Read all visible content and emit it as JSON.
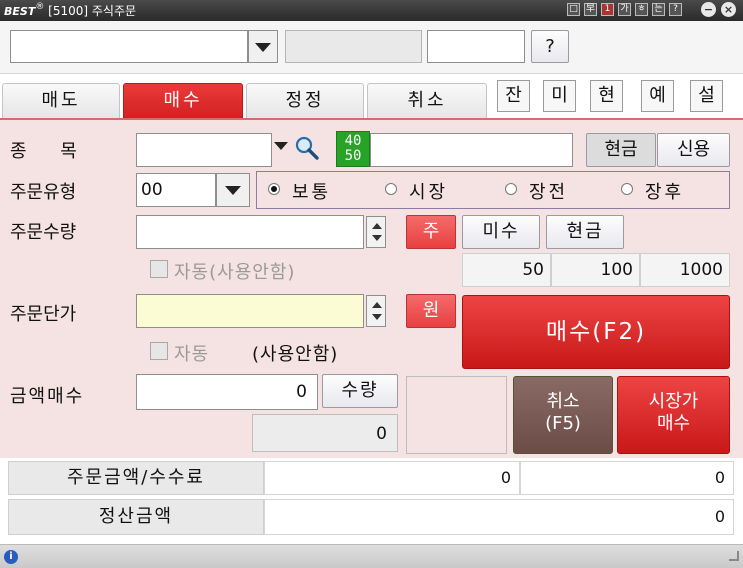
{
  "window": {
    "brand": "BEST",
    "title": "[5100] 주식주문",
    "title_buttons": [
      "□",
      "早",
      "1",
      "가",
      "ㅎ",
      "는",
      "?"
    ],
    "close_glyph": "×",
    "minimize_glyph": "−"
  },
  "toprow": {
    "help_label": "?"
  },
  "tabs": [
    {
      "label": "매도",
      "active": false
    },
    {
      "label": "매수",
      "active": true
    },
    {
      "label": "정정",
      "active": false
    },
    {
      "label": "취소",
      "active": false
    }
  ],
  "info_tabs": [
    "잔",
    "미",
    "현",
    "예",
    "설"
  ],
  "stock": {
    "label": "종 목",
    "search_icon": "magnifier-icon",
    "badge_top": "40",
    "badge_bottom": "50",
    "cash_label": "현금",
    "credit_label": "신용"
  },
  "order_type": {
    "label": "주문유형",
    "value": "00",
    "options": [
      {
        "label": "보통",
        "selected": true
      },
      {
        "label": "시장",
        "selected": false
      },
      {
        "label": "장전",
        "selected": false
      },
      {
        "label": "장후",
        "selected": false
      }
    ]
  },
  "quantity": {
    "label": "주문수량",
    "share_button": "주",
    "unfilled_button": "미수",
    "cash_button": "현금",
    "auto_label": "자동(사용안함)",
    "presets": [
      "50",
      "100",
      "1000"
    ]
  },
  "price": {
    "label": "주문단가",
    "won_button": "원",
    "auto_label": "자동",
    "auto_suffix": "(사용안함)"
  },
  "buttons": {
    "buy": "매수(F2)",
    "cancel_line1": "취소",
    "cancel_line2": "(F5)",
    "market_buy_line1": "시장가",
    "market_buy_line2": "매수"
  },
  "amount_buy": {
    "label": "금액매수",
    "value": "0",
    "qty_button": "수량",
    "qty_value": "0"
  },
  "summary": {
    "order_amount_label": "주문금액/수수료",
    "order_amount_value": "0",
    "fee_value": "0",
    "settlement_label": "정산금액",
    "settlement_value": "0"
  },
  "colors": {
    "accent_red": "#d42020",
    "panel_bg": "#f5e3e4",
    "price_field_bg": "#fcfcd4",
    "badge_green": "#27a327"
  }
}
